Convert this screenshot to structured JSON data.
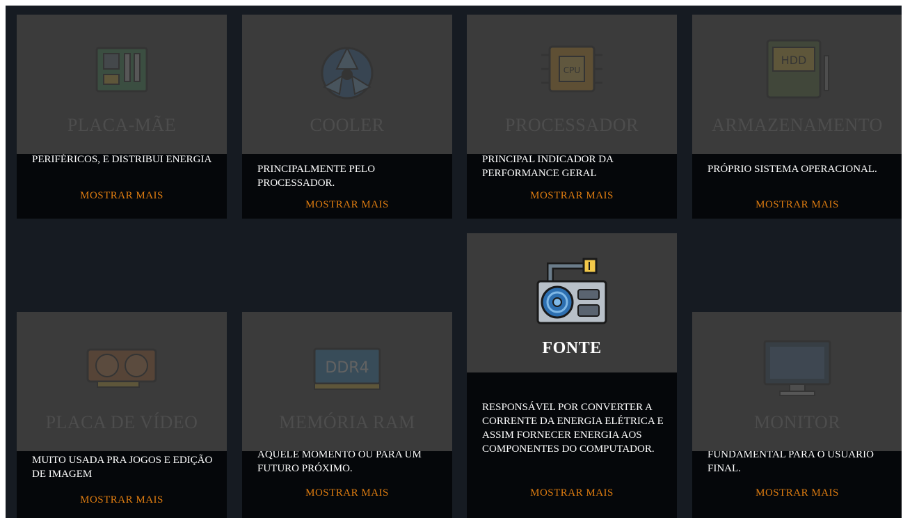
{
  "cards": [
    {
      "title": "PLACA-MÃE",
      "desc": "PERIFÉRICOS, E DISTRIBUI ENERGIA",
      "more": "MOSTRAR MAIS",
      "icon": "motherboard-icon"
    },
    {
      "title": "COOLER",
      "desc": "PRINCIPALMENTE PELO PROCESSADOR.",
      "more": "MOSTRAR MAIS",
      "icon": "cooler-fan-icon"
    },
    {
      "title": "PROCESSADOR",
      "desc": "PRINCIPAL INDICADOR DA PERFORMANCE GERAL",
      "more": "MOSTRAR MAIS",
      "icon": "cpu-chip-icon",
      "icon_text": "CPU"
    },
    {
      "title": "ARMAZENAMENTO",
      "desc": "PRÓPRIO SISTEMA OPERACIONAL.",
      "more": "MOSTRAR MAIS",
      "icon": "hdd-icon",
      "icon_text": "HDD"
    },
    {
      "title": "PLACA DE VÍDEO",
      "desc": "MUITO USADA PRA JOGOS E EDIÇÃO DE IMAGEM",
      "more": "MOSTRAR MAIS",
      "icon": "graphics-card-icon"
    },
    {
      "title": "MEMÓRIA RAM",
      "desc": "AQUELE MOMENTO OU PARA UM FUTURO PRÓXIMO.",
      "more": "MOSTRAR MAIS",
      "icon": "ram-stick-icon",
      "icon_text": "DDR4"
    },
    {
      "title": "FONTE",
      "desc": "RESPONSÁVEL POR CONVERTER A CORRENTE DA ENERGIA ELÉTRICA E ASSIM FORNECER ENERGIA AOS COMPONENTES DO COMPUTADOR.",
      "more": "MOSTRAR MAIS",
      "icon": "power-supply-icon"
    },
    {
      "title": "MONITOR",
      "desc": "FUNDAMENTAL PARA O USUÁRIO FINAL.",
      "more": "MOSTRAR MAIS",
      "icon": "monitor-icon"
    }
  ],
  "colors": {
    "background": "#161b22",
    "card": "#05070a",
    "overlay": "#3b3b3b",
    "accent": "#e07d10"
  }
}
